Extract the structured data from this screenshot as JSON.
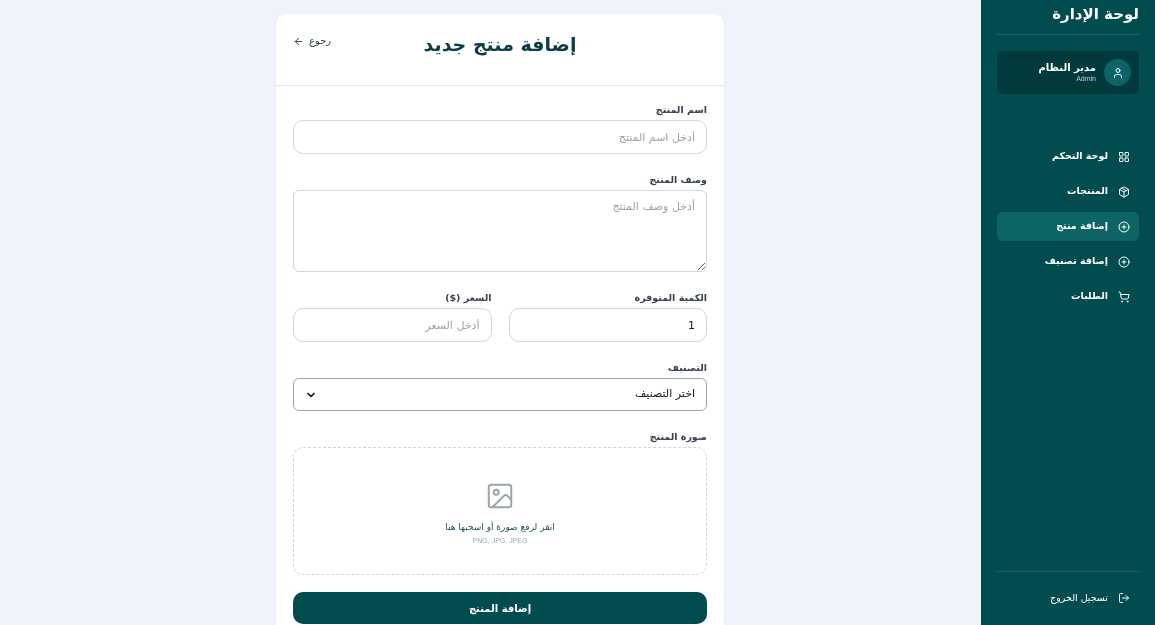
{
  "form": {
    "title": "إضافة منتج جديد",
    "back": "رجوع",
    "fields": [
      {
        "kind": "text",
        "label": "اسم المنتج",
        "placeholder": "أدخل اسم المنتج"
      },
      {
        "kind": "textarea",
        "label": "وصف المنتج",
        "placeholder": "أدخل وصف المنتج"
      },
      {
        "kind": "row",
        "fields": [
          {
            "kind": "text",
            "label": "الكمية المتوفرة",
            "value": "1"
          },
          {
            "kind": "text",
            "label": "السعر ($)",
            "placeholder": "أدخل السعر"
          }
        ]
      },
      {
        "kind": "select",
        "label": "التصنيف",
        "value": "اختر التصنيف"
      },
      {
        "kind": "upload",
        "label": "صورة المنتج",
        "hint": "انقر لرفع صورة أو اسحبها هنا",
        "formats": "PNG, JPG, JPEG"
      }
    ],
    "submit": "إضافة المنتج"
  },
  "sidebar": {
    "title": "لوحة الإدارة",
    "user": {
      "name": "مدير النظام",
      "role": "Admin"
    },
    "nav": [
      {
        "kind": "dashboard",
        "label": "لوحة التحكم",
        "selected": false
      },
      {
        "kind": "products",
        "label": "المنتجات",
        "selected": false
      },
      {
        "kind": "add",
        "label": "إضافة منتج",
        "selected": true
      },
      {
        "kind": "add",
        "label": "إضافة تصنيف",
        "selected": false
      },
      {
        "kind": "orders",
        "label": "الطلبات",
        "selected": false
      }
    ],
    "logout": "تسجيل الخروج"
  }
}
